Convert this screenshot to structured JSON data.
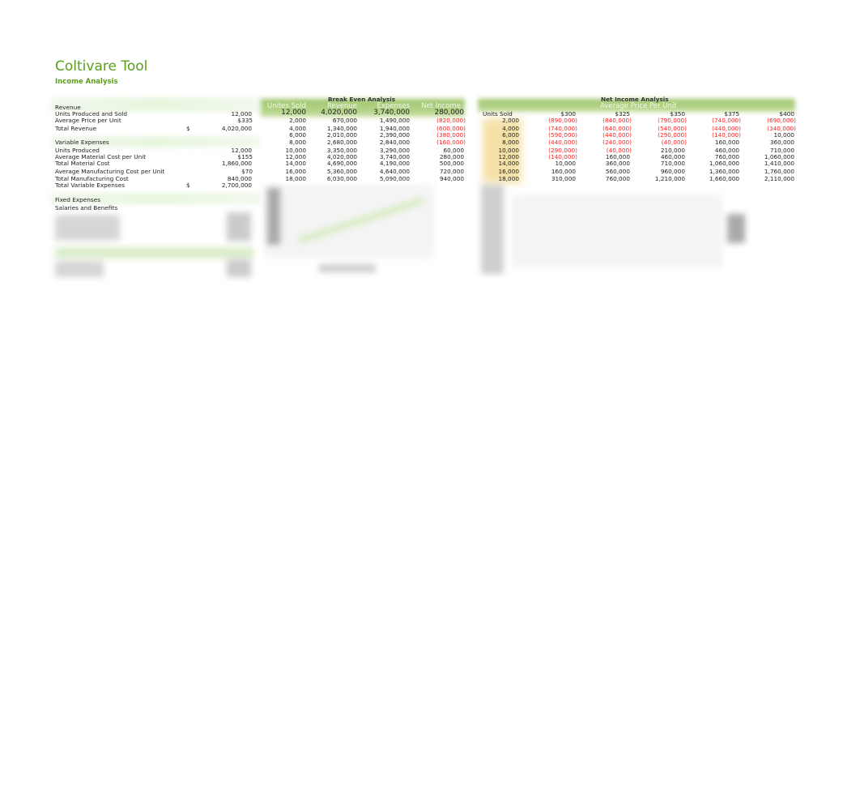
{
  "header": {
    "title": "Coltivare Tool",
    "subtitle": "Income Analysis"
  },
  "income": {
    "revenue_heading": "Revenue",
    "units_sold_label": "Units Produced and Sold",
    "units_sold": "12,000",
    "avg_price_label": "Average Price per Unit",
    "avg_price": "$335",
    "total_revenue_label": "Total Revenue",
    "total_revenue_currency": "$",
    "total_revenue": "4,020,000",
    "variable_heading": "Variable Expenses",
    "units_produced_label": "Units Produced",
    "units_produced": "12,000",
    "avg_material_label": "Average Material Cost per Unit",
    "avg_material": "$155",
    "total_material_label": "Total Material Cost",
    "total_material": "1,860,000",
    "avg_mfg_label": "Average Manufacturing Cost per Unit",
    "avg_mfg": "$70",
    "total_mfg_label": "Total Manufacturing Cost",
    "total_mfg": "840,000",
    "total_variable_label": "Total Variable Expenses",
    "total_variable_currency": "$",
    "total_variable": "2,700,000",
    "fixed_heading": "Fixed Expenses",
    "salaries_label": "Salaries and Benefits"
  },
  "break_even": {
    "title": "Break Even Analysis",
    "columns": [
      "Unites Sold",
      "Revenue",
      "Expenses",
      "Net Income"
    ],
    "current": [
      "12,000",
      "4,020,000",
      "3,740,000",
      "280,000"
    ],
    "rows": [
      [
        "2,000",
        "670,000",
        "1,490,000",
        "(820,000)"
      ],
      [
        "4,000",
        "1,340,000",
        "1,940,000",
        "(600,000)"
      ],
      [
        "6,000",
        "2,010,000",
        "2,390,000",
        "(380,000)"
      ],
      [
        "8,000",
        "2,680,000",
        "2,840,000",
        "(160,000)"
      ],
      [
        "10,000",
        "3,350,000",
        "3,290,000",
        "60,000"
      ],
      [
        "12,000",
        "4,020,000",
        "3,740,000",
        "280,000"
      ],
      [
        "14,000",
        "4,690,000",
        "4,190,000",
        "500,000"
      ],
      [
        "16,000",
        "5,360,000",
        "4,640,000",
        "720,000"
      ],
      [
        "18,000",
        "6,030,000",
        "5,090,000",
        "940,000"
      ]
    ]
  },
  "net_income": {
    "title": "Net Income Analysis",
    "subtitle": "Average Price Per Unit",
    "row_header": "Units Sold",
    "prices": [
      "$300",
      "$325",
      "$350",
      "$375",
      "$400"
    ],
    "rows": [
      {
        "units": "2,000",
        "values": [
          "(890,000)",
          "(840,000)",
          "(790,000)",
          "(740,000)",
          "(690,000)"
        ]
      },
      {
        "units": "4,000",
        "values": [
          "(740,000)",
          "(640,000)",
          "(540,000)",
          "(440,000)",
          "(340,000)"
        ]
      },
      {
        "units": "6,000",
        "values": [
          "(590,000)",
          "(440,000)",
          "(290,000)",
          "(140,000)",
          "10,000"
        ]
      },
      {
        "units": "8,000",
        "values": [
          "(440,000)",
          "(240,000)",
          "(40,000)",
          "160,000",
          "360,000"
        ]
      },
      {
        "units": "10,000",
        "values": [
          "(290,000)",
          "(40,000)",
          "210,000",
          "460,000",
          "710,000"
        ]
      },
      {
        "units": "12,000",
        "values": [
          "(140,000)",
          "160,000",
          "460,000",
          "760,000",
          "1,060,000"
        ]
      },
      {
        "units": "14,000",
        "values": [
          "10,000",
          "360,000",
          "710,000",
          "1,060,000",
          "1,410,000"
        ]
      },
      {
        "units": "16,000",
        "values": [
          "160,000",
          "560,000",
          "960,000",
          "1,360,000",
          "1,760,000"
        ]
      },
      {
        "units": "18,000",
        "values": [
          "310,000",
          "760,000",
          "1,210,000",
          "1,660,000",
          "2,110,000"
        ]
      }
    ]
  },
  "colors": {
    "brand": "#5a9e1a",
    "negative": "#ff2020",
    "header_band": "#9cc46a",
    "highlight": "#f3dc98"
  }
}
